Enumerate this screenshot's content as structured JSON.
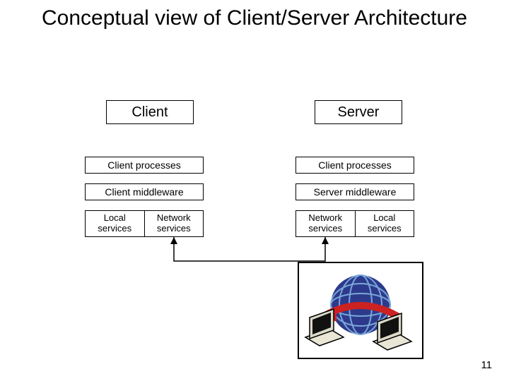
{
  "title": "Conceptual view of Client/Server Architecture",
  "client": {
    "header": "Client",
    "rows": {
      "processes": "Client processes",
      "middleware": "Client middleware",
      "local": "Local\nservices",
      "network": "Network\nservices"
    }
  },
  "server": {
    "header": "Server",
    "rows": {
      "processes": "Client processes",
      "middleware": "Server middleware",
      "network": "Network\nservices",
      "local": "Local\nservices"
    }
  },
  "page_number": "11"
}
